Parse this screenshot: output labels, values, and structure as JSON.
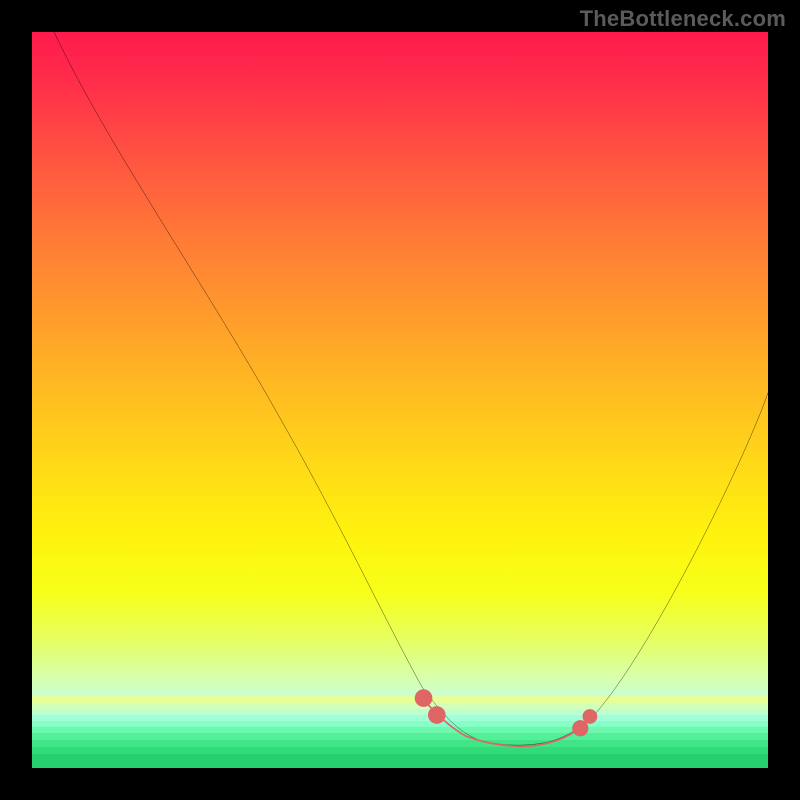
{
  "watermark": {
    "text": "TheBottleneck.com"
  },
  "colors": {
    "background": "#000000",
    "curve": "#000000",
    "highlight": "#e06666",
    "watermark": "#5b5b5b"
  },
  "chart_data": {
    "type": "line",
    "title": "",
    "xlabel": "",
    "ylabel": "",
    "xlim": [
      0,
      100
    ],
    "ylim": [
      0,
      100
    ],
    "grid": false,
    "series": [
      {
        "name": "bottleneck-curve",
        "x": [
          3,
          8,
          14,
          20,
          26,
          32,
          38,
          44,
          48,
          52,
          55,
          58,
          60,
          63,
          66,
          69,
          72,
          74,
          78,
          82,
          86,
          90,
          94,
          98,
          100
        ],
        "y": [
          100,
          92,
          82,
          72,
          61,
          50,
          39,
          27,
          18,
          11,
          7,
          5,
          4,
          3,
          3,
          3,
          4,
          5,
          8,
          13,
          20,
          28,
          37,
          46,
          51
        ]
      }
    ],
    "highlight_region": {
      "note": "bold pink segment near curve minimum",
      "x": [
        53,
        55,
        58,
        60,
        63,
        66,
        69,
        72,
        74,
        75
      ],
      "y": [
        9,
        7,
        5,
        4,
        3,
        3,
        3,
        4,
        5,
        6
      ]
    },
    "green_band_y": [
      0,
      10
    ]
  }
}
